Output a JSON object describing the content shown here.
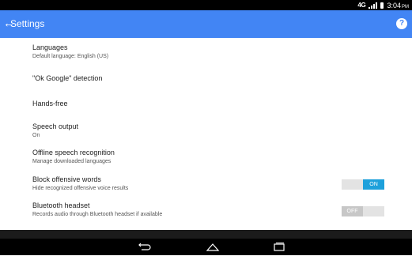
{
  "status_bar": {
    "network": "4G",
    "time": "3:04",
    "time_suffix": "PM"
  },
  "app_bar": {
    "title": "Settings",
    "back_icon": "back-arrow-icon",
    "help_icon": "help-icon",
    "help_glyph": "?"
  },
  "settings": [
    {
      "title": "Languages",
      "subtitle": "Default language: English (US)"
    },
    {
      "title": "\"Ok Google\" detection"
    },
    {
      "title": "Hands-free"
    },
    {
      "title": "Speech output",
      "subtitle": "On"
    },
    {
      "title": "Offline speech recognition",
      "subtitle": "Manage downloaded languages"
    },
    {
      "title": "Block offensive words",
      "subtitle": "Hide recognized offensive voice results",
      "toggle": "ON"
    },
    {
      "title": "Bluetooth headset",
      "subtitle": "Records audio through Bluetooth headset if available",
      "toggle": "OFF"
    }
  ],
  "nav_bar": {
    "back_icon": "back-icon",
    "home_icon": "home-icon",
    "recents_icon": "recents-icon"
  },
  "colors": {
    "app_bar": "#4285f4",
    "toggle_on": "#1da0db",
    "toggle_off": "#c7c7c7"
  }
}
